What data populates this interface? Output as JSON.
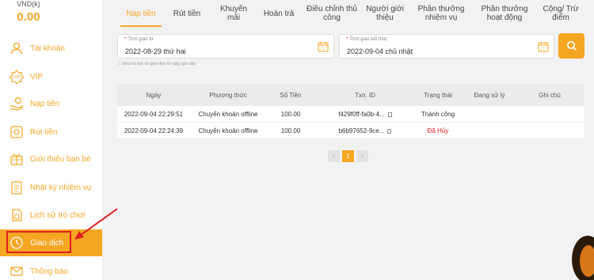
{
  "balance": {
    "currency": "VND(k)",
    "amount": "0.00"
  },
  "sidebar": {
    "items": [
      {
        "label": "Tài khoản",
        "icon": "user-icon"
      },
      {
        "label": "VIP",
        "icon": "vip-badge-icon"
      },
      {
        "label": "Nạp tiền",
        "icon": "deposit-icon"
      },
      {
        "label": "Rút tiền",
        "icon": "withdraw-icon"
      },
      {
        "label": "Giới thiệu bạn bè",
        "icon": "referral-icon"
      },
      {
        "label": "Nhật ký nhiệm vụ",
        "icon": "task-log-icon"
      },
      {
        "label": "Lịch sử trò chơi",
        "icon": "game-history-icon"
      },
      {
        "label": "Giao dịch",
        "icon": "transaction-icon",
        "active": true
      },
      {
        "label": "Thông báo",
        "icon": "mail-icon"
      }
    ]
  },
  "tabs": [
    {
      "label": "Nạp tiền",
      "active": true
    },
    {
      "label": "Rút tiền"
    },
    {
      "label": "Khuyến mãi"
    },
    {
      "label": "Hoàn trả"
    },
    {
      "label": "Điều chỉnh thủ công"
    },
    {
      "label": "Người giới thiệu"
    },
    {
      "label": "Phần thưởng nhiệm vụ"
    },
    {
      "label": "Phần thưởng hoạt động"
    },
    {
      "label": "Cộng/ Trừ điểm"
    }
  ],
  "filters": {
    "start": {
      "caption": "Thời gian từ",
      "value": "2022-08-29 thứ hai"
    },
    "end": {
      "caption": "Thời gian kết thúc",
      "value": "2022-09-04 chủ nhật"
    },
    "hint": "ⓘ Điều tra lịch sử giao dịch từ ngày gần đây"
  },
  "table": {
    "headers": [
      "Ngày",
      "Phương thức",
      "Số Tiền",
      "Txn. ID",
      "Trạng thái",
      "Đang xử lý",
      "Ghi chú"
    ],
    "rows": [
      {
        "date": "2022-09-04 22:29:51",
        "method": "Chuyển khoản offline",
        "amount": "100.00",
        "txn": "f429f0ff-fa0b-4...",
        "status": "Thành công",
        "status_color": "#333333"
      },
      {
        "date": "2022-09-04 22:24:39",
        "method": "Chuyển khoản offline",
        "amount": "100.00",
        "txn": "b6b97652-9ce...",
        "status": "Đã Hủy",
        "status_color": "#e01e1e"
      }
    ]
  },
  "pagination": {
    "prev": "‹",
    "current": "1",
    "next": "›"
  },
  "colors": {
    "accent": "#f5a623",
    "annotation": "#e01e1e"
  }
}
